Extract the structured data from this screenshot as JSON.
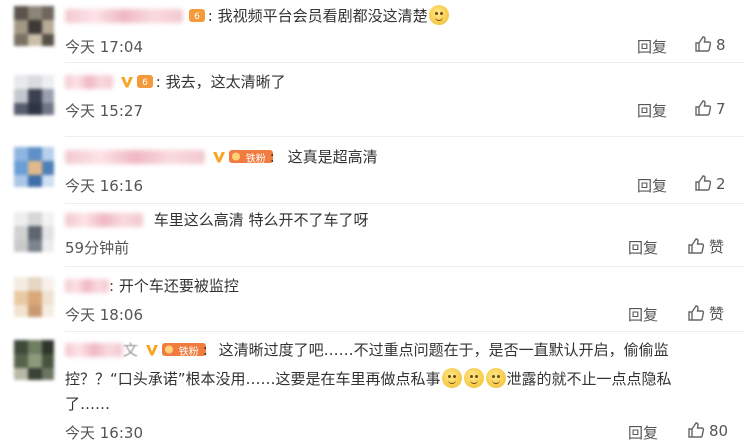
{
  "comments": [
    {
      "text": "我视频平台会员看剧都没这清楚",
      "time": "今天 17:04",
      "reply": "回复",
      "likes": "8",
      "emoji": true
    },
    {
      "text": "我去，这太清晰了",
      "time": "今天 15:27",
      "reply": "回复",
      "likes": "7"
    },
    {
      "text": "这真是超高清",
      "time": "今天 16:16",
      "reply": "回复",
      "likes": "2",
      "badge": "铁粉"
    },
    {
      "text": "车里这么高清 特么开不了车了呀",
      "time": "59分钟前",
      "reply": "回复",
      "likes": "赞"
    },
    {
      "text": "开个车还要被监控",
      "time": "今天 18:06",
      "reply": "回复",
      "likes": "赞"
    },
    {
      "text_part1": "这清晰过度了吧……不过重点问题在于，是否一直默认开启，偷偷监",
      "text_part2": "控？？“口头承诺”根本没用……这要是在车里再做点私事",
      "text_part3": "泄露的就不止一点点隐私",
      "text_part4": "了……",
      "badge": "铁粉",
      "name_suffix": "文",
      "time": "今天 16:30",
      "reply": "回复",
      "likes": "80"
    }
  ],
  "icons": {
    "like": "thumbs-up-icon",
    "vip": "vip-v-icon",
    "level": "user-level-icon"
  },
  "colors": {
    "vip": "#f5a623",
    "fan_badge": "#f07c3f",
    "divider": "#ececec"
  }
}
